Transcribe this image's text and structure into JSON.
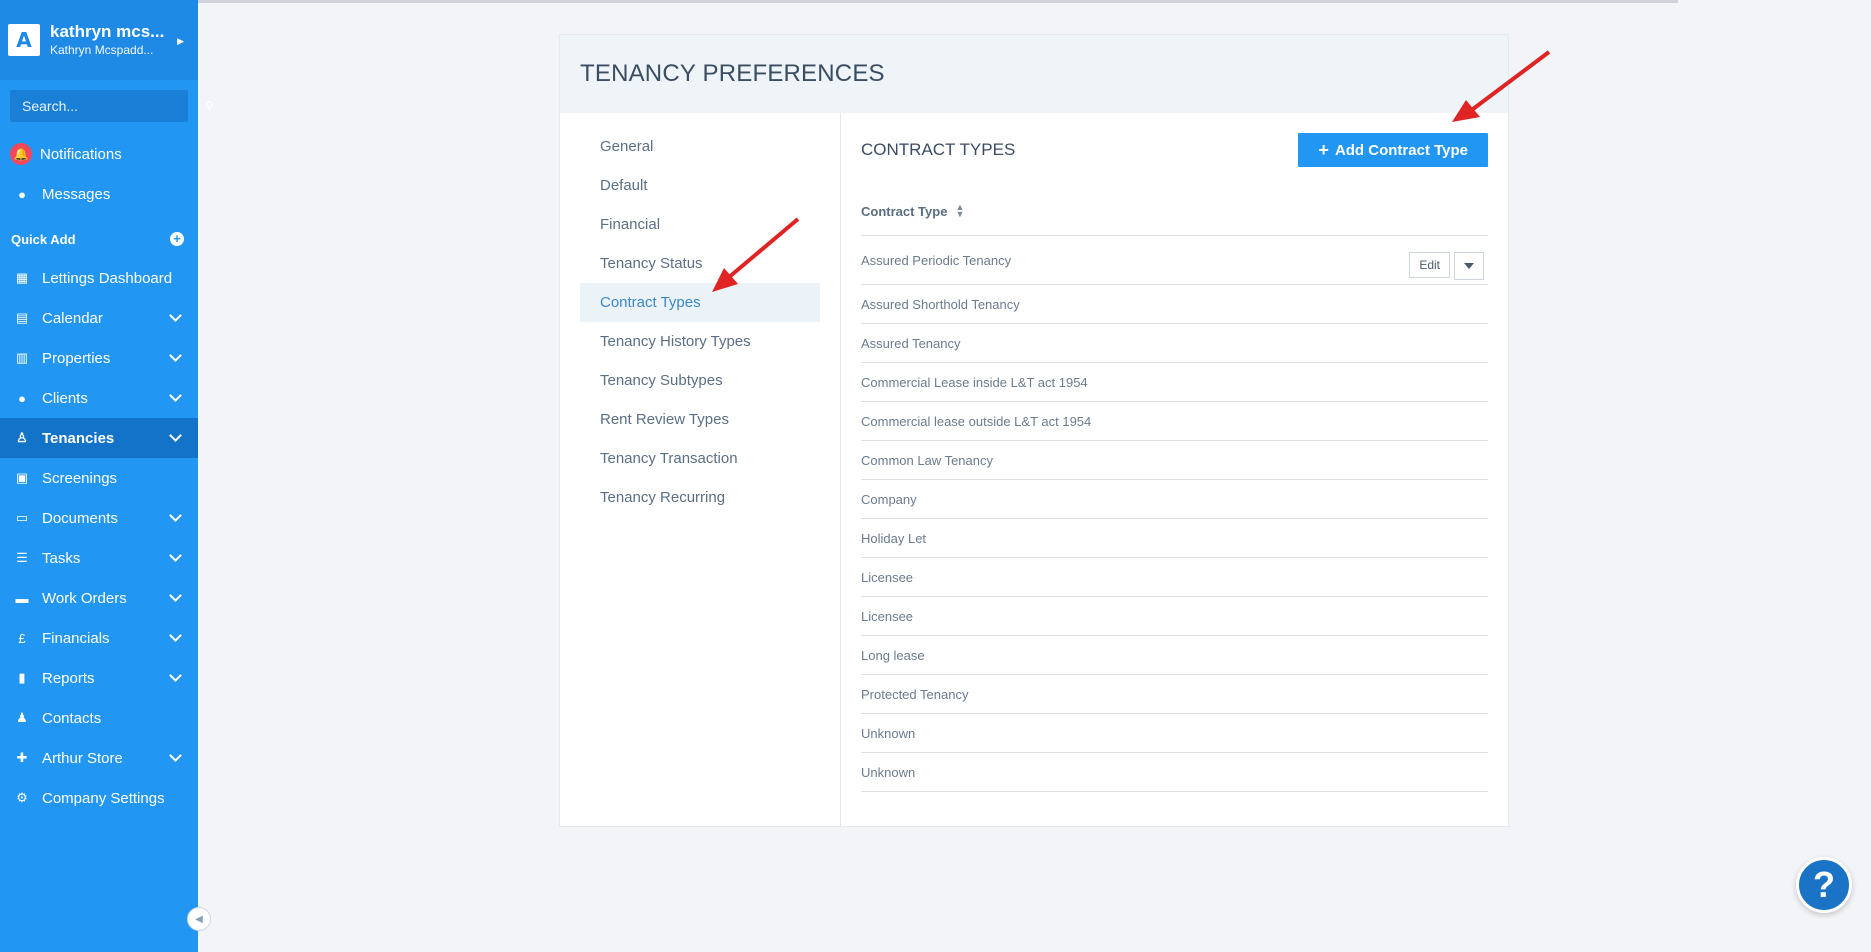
{
  "user": {
    "name": "kathryn mcs...",
    "subtitle": "Kathryn Mcspadd..."
  },
  "search": {
    "placeholder": "Search..."
  },
  "sidebar": {
    "notifications": "Notifications",
    "messages": "Messages",
    "quick_add": "Quick Add",
    "items": [
      {
        "label": "Lettings Dashboard",
        "icon": "dashboard-icon",
        "expandable": false
      },
      {
        "label": "Calendar",
        "icon": "calendar-icon",
        "expandable": true
      },
      {
        "label": "Properties",
        "icon": "building-icon",
        "expandable": true
      },
      {
        "label": "Clients",
        "icon": "user-icon",
        "expandable": true
      },
      {
        "label": "Tenancies",
        "icon": "tenancy-icon",
        "expandable": true,
        "active": true
      },
      {
        "label": "Screenings",
        "icon": "screening-icon",
        "expandable": false
      },
      {
        "label": "Documents",
        "icon": "document-icon",
        "expandable": true
      },
      {
        "label": "Tasks",
        "icon": "tasks-icon",
        "expandable": true
      },
      {
        "label": "Work Orders",
        "icon": "briefcase-icon",
        "expandable": true
      },
      {
        "label": "Financials",
        "icon": "pound-icon",
        "expandable": true
      },
      {
        "label": "Reports",
        "icon": "chart-icon",
        "expandable": true
      },
      {
        "label": "Contacts",
        "icon": "contacts-icon",
        "expandable": false
      },
      {
        "label": "Arthur Store",
        "icon": "puzzle-icon",
        "expandable": true
      },
      {
        "label": "Company Settings",
        "icon": "gear-icon",
        "expandable": false
      }
    ]
  },
  "page": {
    "title": "TENANCY PREFERENCES",
    "menu": [
      "General",
      "Default",
      "Financial",
      "Tenancy Status",
      "Contract Types",
      "Tenancy History Types",
      "Tenancy Subtypes",
      "Rent Review Types",
      "Tenancy Transaction",
      "Tenancy Recurring"
    ],
    "active_menu": "Contract Types",
    "section_title": "CONTRACT TYPES",
    "add_button": "Add Contract Type",
    "column_header": "Contract Type",
    "edit_label": "Edit",
    "rows": [
      "Assured Periodic Tenancy",
      "Assured Shorthold Tenancy",
      "Assured Tenancy",
      "Commercial Lease inside L&T act 1954",
      "Commercial lease outside L&T act 1954",
      "Common Law Tenancy",
      "Company",
      "Holiday Let",
      "Licensee",
      "Licensee",
      "Long lease",
      "Protected Tenancy",
      "Unknown",
      "Unknown"
    ]
  },
  "help": {
    "label": "?"
  },
  "colors": {
    "sidebar": "#2196f3",
    "sidebar_active": "#1373c9",
    "accent": "#2196f3",
    "annotation_arrow": "#e02424"
  }
}
